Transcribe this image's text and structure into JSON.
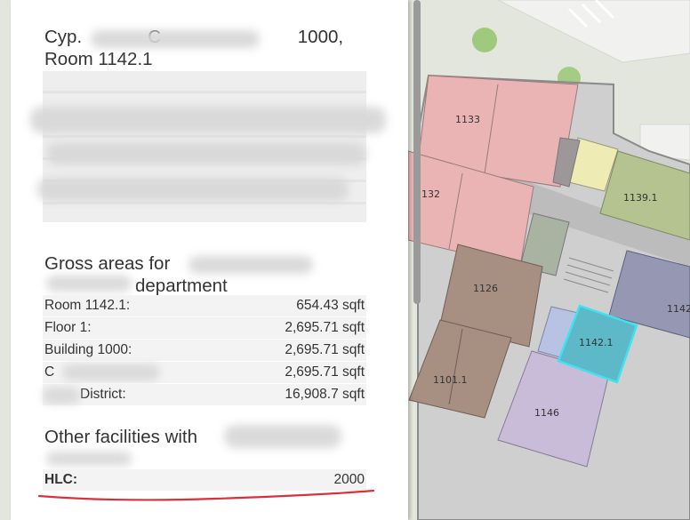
{
  "panel": {
    "title_line1": "Cyp.             C                           1000,",
    "title_line2": "Room 1142.1",
    "gross_heading_line1": "Gross areas for",
    "gross_heading_line2": "department",
    "area_rows": [
      {
        "label": "Room 1142.1:",
        "value": "654.43 sqft"
      },
      {
        "label": "Floor 1:",
        "value": "2,695.71 sqft"
      },
      {
        "label": "Building 1000:",
        "value": "2,695.71 sqft"
      },
      {
        "label": "C",
        "value": "2,695.71 sqft"
      },
      {
        "label": "District:",
        "value": "16,908.7 sqft"
      }
    ],
    "other_heading": "Other facilities with",
    "facility_row": {
      "label": "HLC:",
      "value": "2000"
    }
  },
  "map": {
    "rooms": [
      "1133",
      "132",
      "1139.1",
      "1126",
      "1142.1",
      "1101.1",
      "1146",
      "1142"
    ],
    "highlight_color": "#58b8c9",
    "highlight_border": "#3fe2f0"
  },
  "colors": {
    "annotation_red": "#d9303a"
  }
}
